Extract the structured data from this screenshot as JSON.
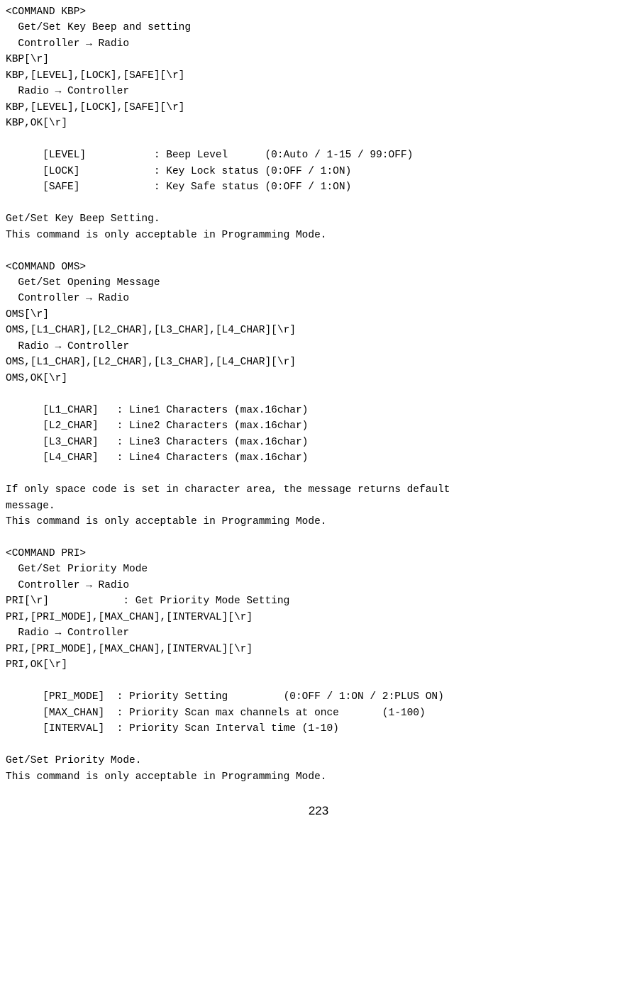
{
  "kbp": {
    "tag": "<COMMAND KBP>",
    "title": "Get/Set Key Beep and setting",
    "dir1": "Controller → Radio",
    "req1": "KBP[\\r]",
    "req2": "KBP,[LEVEL],[LOCK],[SAFE][\\r]",
    "dir2": "Radio → Controller",
    "res1": "KBP,[LEVEL],[LOCK],[SAFE][\\r]",
    "res2": "KBP,OK[\\r]",
    "p_level": "      [LEVEL]           : Beep Level      (0:Auto / 1-15 / 99:OFF)",
    "p_lock": "      [LOCK]            : Key Lock status (0:OFF / 1:ON)",
    "p_safe": "      [SAFE]            : Key Safe status (0:OFF / 1:ON)",
    "desc1": "Get/Set Key Beep Setting.",
    "desc2": "This command is only acceptable in Programming Mode."
  },
  "oms": {
    "tag": "<COMMAND OMS>",
    "title": "Get/Set Opening Message",
    "dir1": "Controller → Radio",
    "req1": "OMS[\\r]",
    "req2": "OMS,[L1_CHAR],[L2_CHAR],[L3_CHAR],[L4_CHAR][\\r]",
    "dir2": "Radio → Controller",
    "res1": "OMS,[L1_CHAR],[L2_CHAR],[L3_CHAR],[L4_CHAR][\\r]",
    "res2": "OMS,OK[\\r]",
    "p_l1": "      [L1_CHAR]   : Line1 Characters (max.16char)",
    "p_l2": "      [L2_CHAR]   : Line2 Characters (max.16char)",
    "p_l3": "      [L3_CHAR]   : Line3 Characters (max.16char)",
    "p_l4": "      [L4_CHAR]   : Line4 Characters (max.16char)",
    "desc1a": "If only space code is set in character area, the message returns default",
    "desc1b": "message.",
    "desc2": "This command is only acceptable in Programming Mode."
  },
  "pri": {
    "tag": "<COMMAND PRI>",
    "title": "Get/Set Priority Mode",
    "dir1": "Controller → Radio",
    "req1": "PRI[\\r]            : Get Priority Mode Setting",
    "req2": "PRI,[PRI_MODE],[MAX_CHAN],[INTERVAL][\\r]",
    "dir2": "Radio → Controller",
    "res1": "PRI,[PRI_MODE],[MAX_CHAN],[INTERVAL][\\r]",
    "res2": "PRI,OK[\\r]",
    "p_mode": "      [PRI_MODE]  : Priority Setting         (0:OFF / 1:ON / 2:PLUS ON)",
    "p_chan": "      [MAX_CHAN]  : Priority Scan max channels at once       (1-100)",
    "p_int": "      [INTERVAL]  : Priority Scan Interval time (1-10)",
    "desc1": "Get/Set Priority Mode.",
    "desc2": "This command is only acceptable in Programming Mode."
  },
  "page_number": "223"
}
